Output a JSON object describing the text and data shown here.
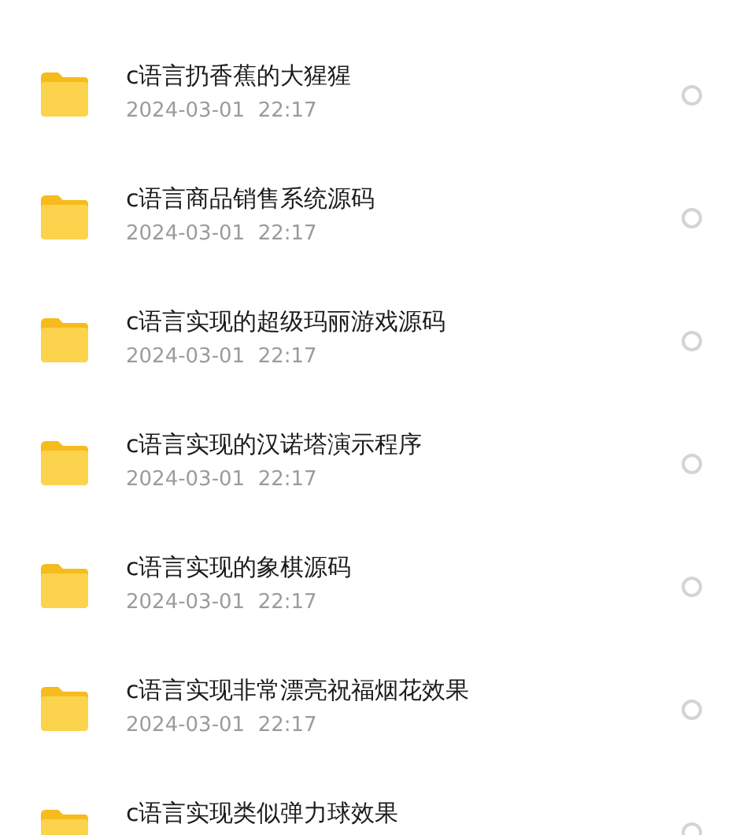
{
  "files": [
    {
      "title": "c语言扔香蕉的大猩猩",
      "date": "2024-03-01  22:17",
      "selected": false
    },
    {
      "title": "c语言商品销售系统源码",
      "date": "2024-03-01  22:17",
      "selected": false
    },
    {
      "title": "c语言实现的超级玛丽游戏源码",
      "date": "2024-03-01  22:17",
      "selected": false
    },
    {
      "title": "c语言实现的汉诺塔演示程序",
      "date": "2024-03-01  22:17",
      "selected": false
    },
    {
      "title": "c语言实现的象棋源码",
      "date": "2024-03-01  22:17",
      "selected": false
    },
    {
      "title": "c语言实现非常漂亮祝福烟花效果",
      "date": "2024-03-01  22:17",
      "selected": false
    },
    {
      "title": "c语言实现类似弹力球效果",
      "selected": false
    }
  ]
}
